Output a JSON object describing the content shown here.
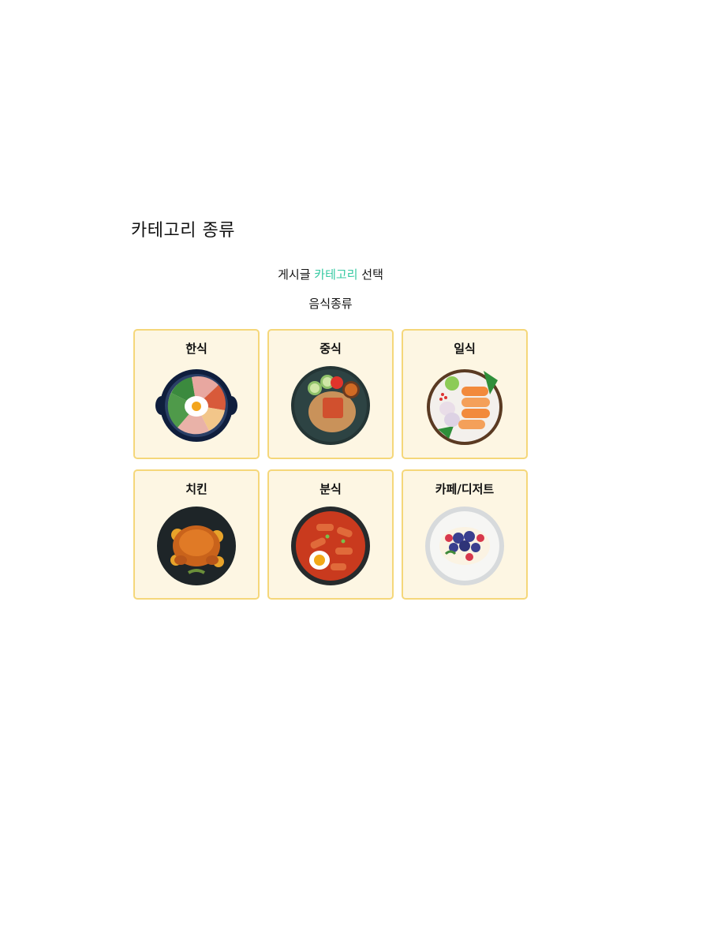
{
  "header": {
    "title": "카테고리 종류"
  },
  "select": {
    "prefix": "게시글",
    "accent": "카테고리",
    "suffix": "선택"
  },
  "group": {
    "label": "음식종류"
  },
  "categories": [
    {
      "label": "한식",
      "icon": "bibimbap-icon"
    },
    {
      "label": "중식",
      "icon": "fried-rice-icon"
    },
    {
      "label": "일식",
      "icon": "salmon-sashimi-icon"
    },
    {
      "label": "치킨",
      "icon": "roast-chicken-icon"
    },
    {
      "label": "분식",
      "icon": "tteokbokki-icon"
    },
    {
      "label": "카페/디저트",
      "icon": "berry-dessert-icon"
    }
  ],
  "colors": {
    "accent": "#35c9a2",
    "card_border": "#f5d77a",
    "card_bg": "#fdf6e3"
  }
}
